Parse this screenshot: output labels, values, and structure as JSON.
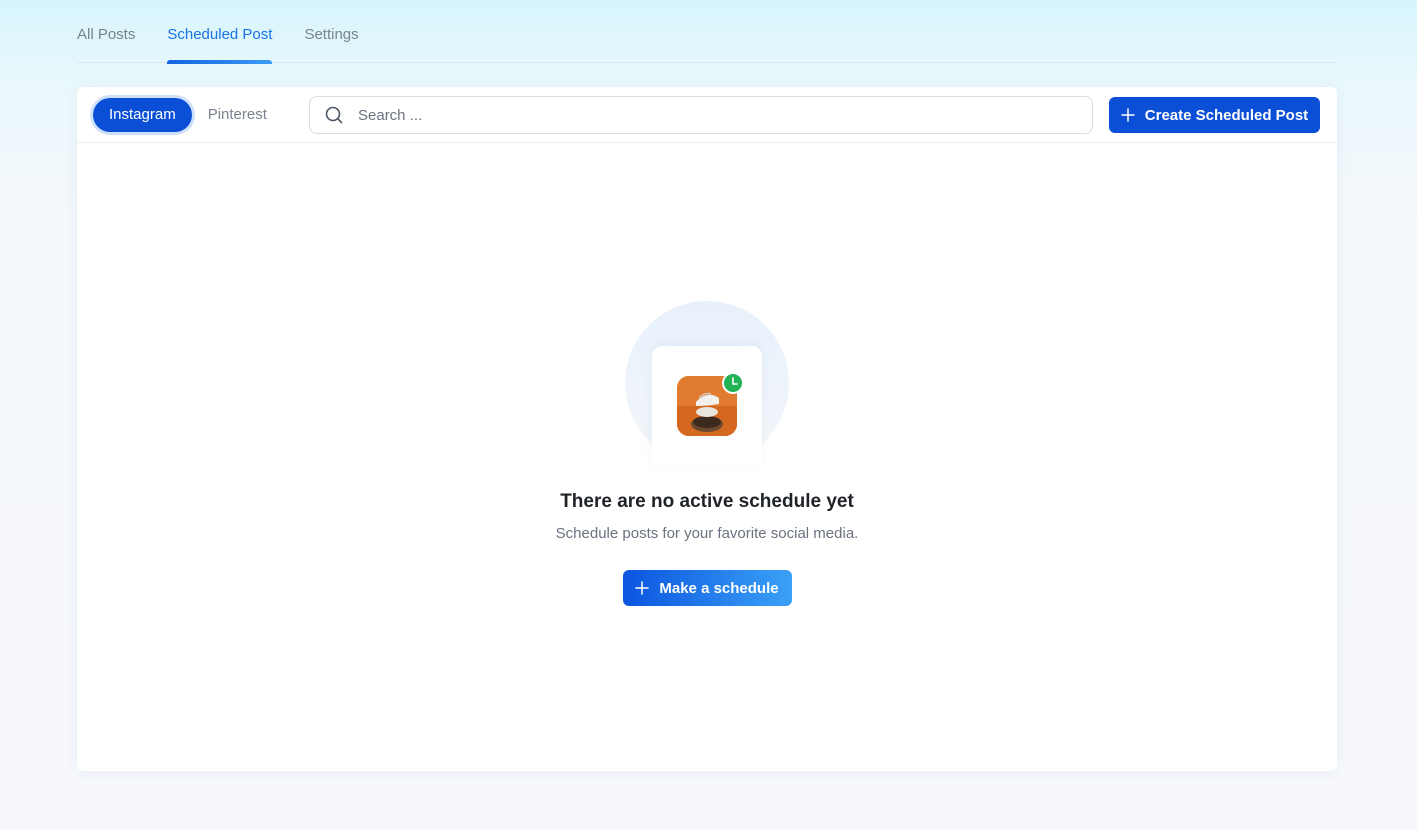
{
  "top_tabs": [
    {
      "label": "All Posts"
    },
    {
      "label": "Scheduled Post"
    },
    {
      "label": "Settings"
    }
  ],
  "toolbar": {
    "platforms": [
      {
        "label": "Instagram"
      },
      {
        "label": "Pinterest"
      }
    ],
    "search_placeholder": "Search ...",
    "search_icon": "search-icon",
    "create_button_label": "Create Scheduled Post",
    "create_button_icon": "plus-icon"
  },
  "empty_state": {
    "illustration_icon": "scheduled-post-illustration",
    "badge_icon": "clock-icon",
    "title": "There are no active schedule yet",
    "subtitle": "Schedule posts for your favorite social media.",
    "button_label": "Make a schedule",
    "button_icon": "plus-icon"
  },
  "colors": {
    "primary": "#0b4fd6",
    "active_tab": "#1a73e8",
    "badge_green": "#22b357",
    "muted_text": "#7a8391"
  }
}
